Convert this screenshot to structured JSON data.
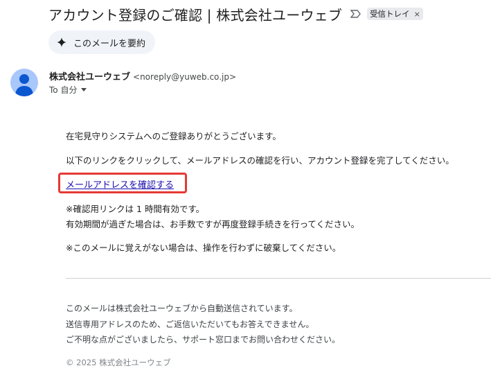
{
  "header": {
    "subject": "アカウント登録のご確認 | 株式会社ユーウェブ",
    "label": "受信トレイ",
    "label_remove": "×"
  },
  "summary": {
    "label": "このメールを要約"
  },
  "sender": {
    "name": "株式会社ユーウェブ",
    "email": "<noreply@yuweb.co.jp>",
    "to": "To 自分"
  },
  "body": {
    "line1": "在宅見守りシステムへのご登録ありがとうございます。",
    "line2": "以下のリンクをクリックして、メールアドレスの確認を行い、アカウント登録を完了してください。",
    "link": "メールアドレスを確認する",
    "note1": "※確認用リンクは 1 時間有効です。",
    "note2": "有効期間が過ぎた場合は、お手数ですが再度登録手続きを行ってください。",
    "note3": "※このメールに覚えがない場合は、操作を行わずに破棄してください。"
  },
  "footer": {
    "line1": "このメールは株式会社ユーウェブから自動送信されています。",
    "line2": "送信専用アドレスのため、ご返信いただいてもお答えできません。",
    "line3": "ご不明な点がございましたら、サポート窓口までお問い合わせください。",
    "copyright": "© 2025 株式会社ユーウェブ"
  },
  "colors": {
    "link": "#1a0dab",
    "highlight": "#e53935",
    "avatar": "#a8c7fa"
  },
  "icons": [
    "importance-marker-icon",
    "sparkle-icon",
    "person-icon",
    "chevron-down-icon"
  ]
}
